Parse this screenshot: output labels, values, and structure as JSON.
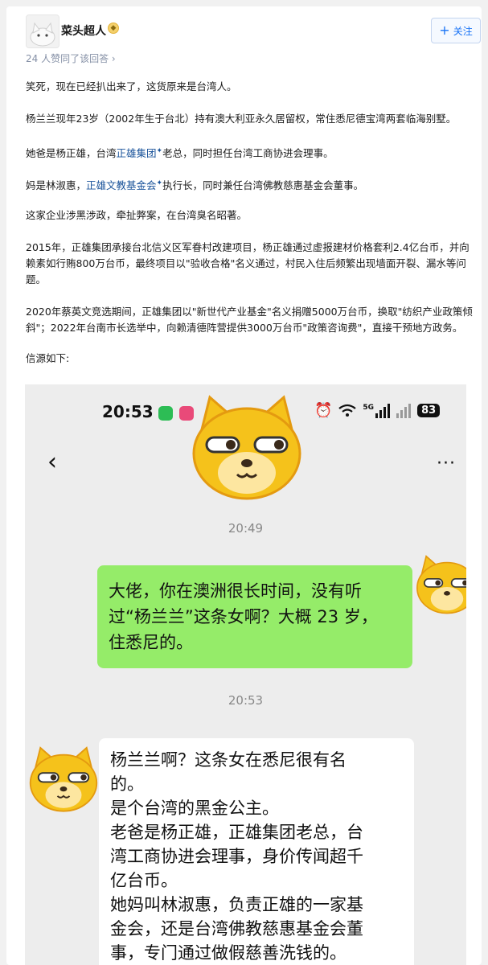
{
  "author": {
    "name": "菜头超人"
  },
  "header": {
    "follow_label": "关注",
    "upvote_text": "24 人赞同了该回答 ›"
  },
  "article": {
    "p1": "笑死，现在已经扒出来了，这货原来是台湾人。",
    "p2": "杨兰兰现年23岁（2002年生于台北）持有澳大利亚永久居留权，常住悉尼德宝湾两套临海别墅。",
    "p3a": "她爸是杨正雄，台湾",
    "p3_link": "正雄集团",
    "p3b": "老总，同时担任台湾工商协进会理事。",
    "p4a": "妈是林淑惠，",
    "p4_link": "正雄文教基金会",
    "p4b": "执行长，同时兼任台湾佛教慈惠基金会董事。",
    "p5": "这家企业涉黑涉政，牵扯弊案，在台湾臭名昭著。",
    "p6": "2015年，正雄集团承接台北信义区军眷村改建项目，杨正雄通过虚报建材价格套利2.4亿台币，并向赖素如行贿800万台币，最终项目以\"验收合格\"名义通过，村民入住后频繁出现墙面开裂、漏水等问题。",
    "p7": "2020年蔡英文竞选期间，正雄集团以\"新世代产业基金\"名义捐赠5000万台币，换取\"纺织产业政策倾斜\"；2022年台南市长选举中，向赖清德阵营提供3000万台币\"政策咨询费\"，直接干预地方政务。",
    "p8": "信源如下:"
  },
  "screenshot": {
    "status": {
      "time": "20:53",
      "battery": "83",
      "network": "5G"
    },
    "timestamp1": "20:49",
    "timestamp2": "20:53",
    "msg_me": "大佬，你在澳洲很长时间，没有听\n过“杨兰兰”这条女啊？大概 23 岁，\n住悉尼的。",
    "msg_other": "杨兰兰啊？这条女在悉尼很有名\n的。\n是个台湾的黑金公主。\n老爸是杨正雄，正雄集团老总，台\n湾工商协进会理事，身价传闻超千\n亿台币。\n她妈叫林淑惠，负责正雄的一家基\n金会，还是台湾佛教慈惠基金会董\n事，专门通过做假慈善洗钱的。"
  },
  "icons": {
    "follow": "plus-icon",
    "back": "chevron-left-icon",
    "more": "more-dots-icon",
    "emoji": "dog-face-sticker",
    "alarm": "alarm-icon",
    "wifi": "wifi-icon"
  },
  "colors": {
    "link": "#175199",
    "follow": "#1772f6",
    "bubble_me": "#95ec69",
    "chat_bg": "#ededed"
  }
}
